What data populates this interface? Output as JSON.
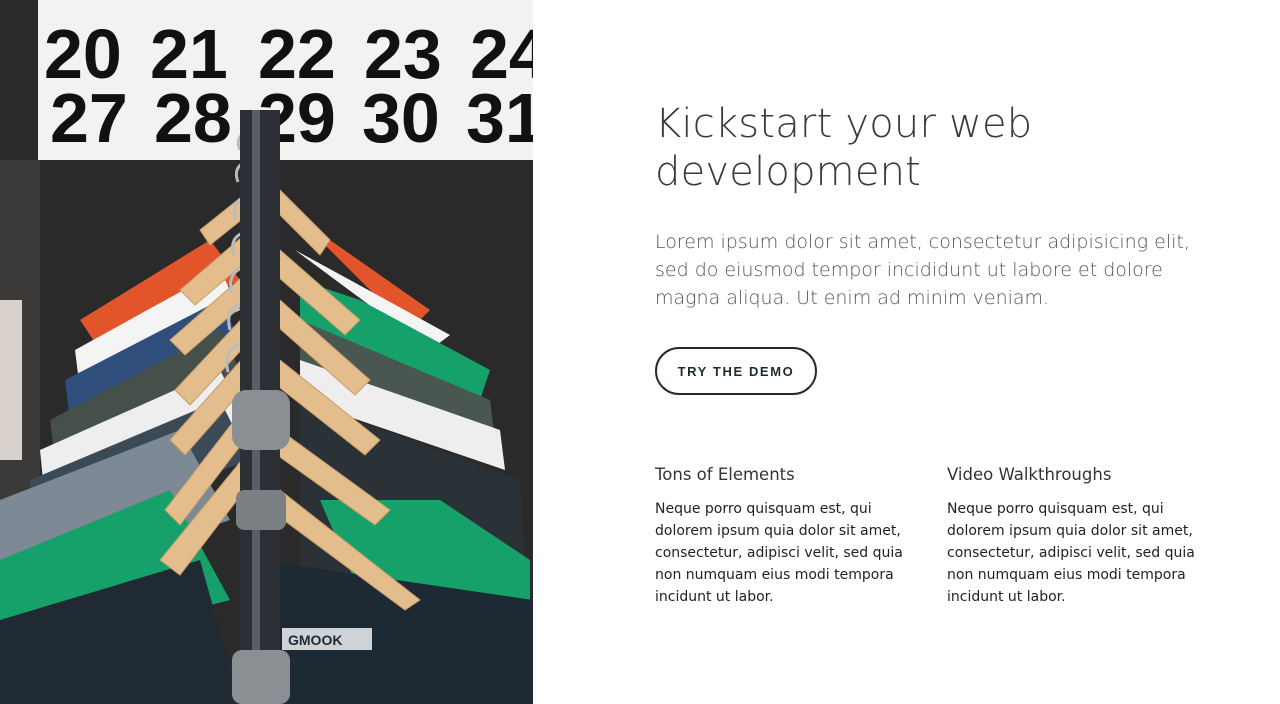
{
  "hero": {
    "image_alt": "Clothes on hangers in front of a calendar",
    "calendar_numbers": [
      "20",
      "21",
      "22",
      "23",
      "24",
      "27",
      "28",
      "29",
      "30",
      "31"
    ],
    "shirt_tag_text": "GMOOK"
  },
  "main": {
    "headline_line1": "Kickstart your web",
    "headline_line2": "development",
    "lead": "Lorem ipsum dolor sit amet, consectetur adipisicing elit, sed do eiusmod tempor incididunt ut labore et dolore magna aliqua. Ut enim ad minim veniam.",
    "cta_label": "TRY THE DEMO"
  },
  "features": [
    {
      "title": "Tons of Elements",
      "body": "Neque porro quisquam est, qui dolorem ipsum quia dolor sit amet, consectetur, adipisci velit, sed quia non numquam eius modi tempora incidunt ut labor."
    },
    {
      "title": "Video Walkthroughs",
      "body": "Neque porro quisquam est, qui dolorem ipsum quia dolor sit amet, consectetur, adipisci velit, sed quia non numquam eius modi tempora incidunt ut labor."
    }
  ],
  "colors": {
    "background": "#ffffff",
    "heading": "#3a3a3a",
    "button_border": "#1e2b33",
    "shirt_orange": "#e2542a",
    "shirt_green": "#16a06a",
    "hanger_wood": "#e4bd8d"
  }
}
